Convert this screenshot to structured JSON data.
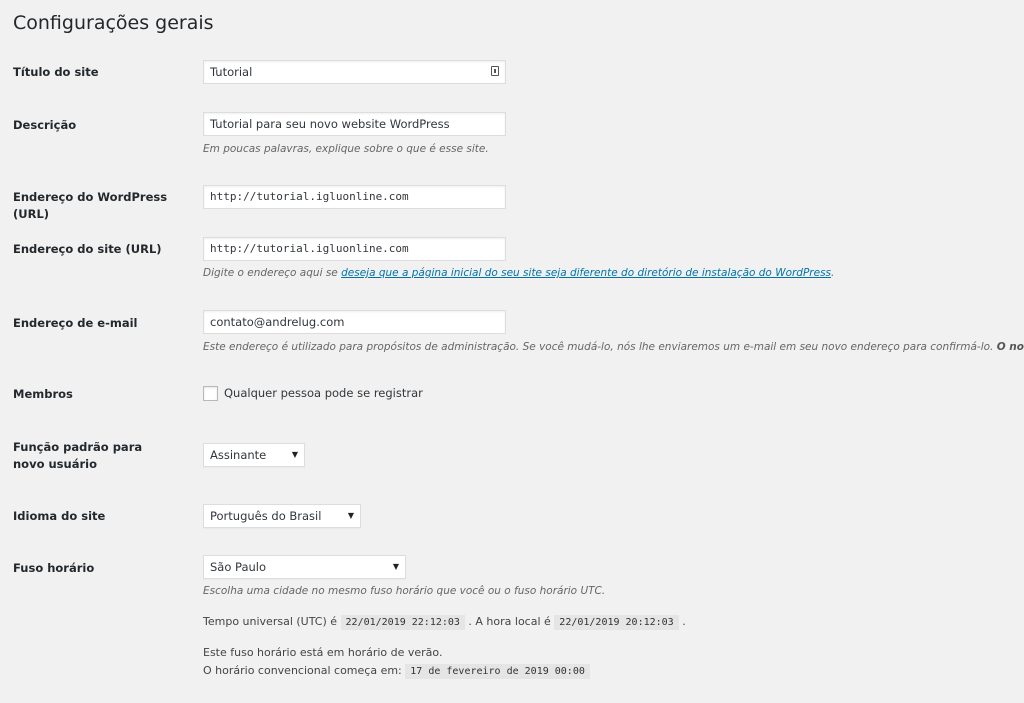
{
  "page_title": "Configurações gerais",
  "fields": {
    "site_title": {
      "label": "Título do site",
      "value": "Tutorial"
    },
    "tagline": {
      "label": "Descrição",
      "value": "Tutorial para seu novo website WordPress",
      "hint": "Em poucas palavras, explique sobre o que é esse site."
    },
    "wp_url": {
      "label": "Endereço do WordPress (URL)",
      "value": "http://tutorial.igluonline.com"
    },
    "site_url": {
      "label": "Endereço do site (URL)",
      "value": "http://tutorial.igluonline.com",
      "hint_prefix": "Digite o endereço aqui se ",
      "hint_link": "deseja que a página inicial do seu site seja diferente do diretório de instalação do WordPress",
      "hint_suffix": "."
    },
    "email": {
      "label": "Endereço de e-mail",
      "value": "contato@andrelug.com",
      "hint": "Este endereço é utilizado para propósitos de administração. Se você mudá-lo, nós lhe enviaremos um e-mail em seu novo endereço para confirmá-lo. ",
      "hint_bold": "O novo"
    },
    "membership": {
      "label": "Membros",
      "checkbox_label": "Qualquer pessoa pode se registrar",
      "checked": false
    },
    "default_role": {
      "label": "Função padrão para novo usuário",
      "value": "Assinante"
    },
    "language": {
      "label": "Idioma do site",
      "value": "Português do Brasil"
    },
    "timezone": {
      "label": "Fuso horário",
      "value": "São Paulo",
      "hint": "Escolha uma cidade no mesmo fuso horário que você ou o fuso horário UTC.",
      "utc_prefix": "Tempo universal (UTC) é",
      "utc_time": "22/01/2019 22:12:03",
      "local_prefix": ". A hora local é",
      "local_time": "22/01/2019 20:12:03",
      "local_suffix": ".",
      "dst_note": "Este fuso horário está em horário de verão.",
      "standard_prefix": "O horário convencional começa em:",
      "standard_time": "17 de fevereiro de 2019 00:00"
    }
  },
  "icons": {
    "site_title_field": "password-manager-icon",
    "select_arrow": "caret-down-icon"
  }
}
